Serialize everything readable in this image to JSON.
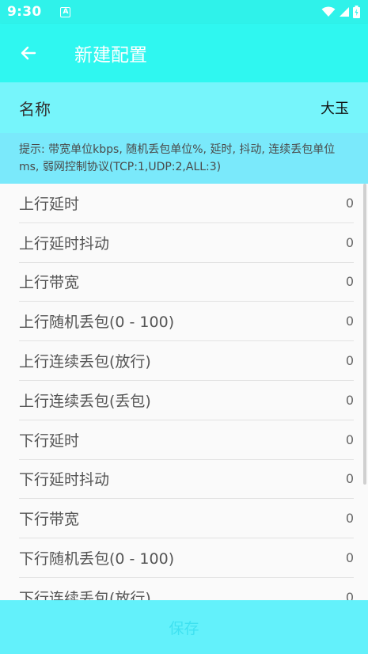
{
  "status_bar": {
    "time": "9:30",
    "notification_icon": "a-notification-icon",
    "icons": [
      "wifi-icon",
      "signal-icon",
      "battery-icon"
    ]
  },
  "app_bar": {
    "title": "新建配置",
    "back_icon": "arrow-left-icon"
  },
  "name_row": {
    "label": "名称",
    "value": "大玉"
  },
  "hint": "提示: 带宽单位kbps, 随机丢包单位%, 延时, 抖动, 连续丢包单位ms, 弱网控制协议(TCP:1,UDP:2,ALL:3)",
  "fields": [
    {
      "label": "上行延时",
      "value": "0"
    },
    {
      "label": "上行延时抖动",
      "value": "0"
    },
    {
      "label": "上行带宽",
      "value": "0"
    },
    {
      "label": "上行随机丢包(0 - 100)",
      "value": "0"
    },
    {
      "label": "上行连续丢包(放行)",
      "value": "0"
    },
    {
      "label": "上行连续丢包(丢包)",
      "value": "0"
    },
    {
      "label": "下行延时",
      "value": "0"
    },
    {
      "label": "下行延时抖动",
      "value": "0"
    },
    {
      "label": "下行带宽",
      "value": "0"
    },
    {
      "label": "下行随机丢包(0 - 100)",
      "value": "0"
    },
    {
      "label": "下行连续丢包(放行)",
      "value": "0"
    }
  ],
  "save_label": "保存",
  "colors": {
    "status_bar": "#2ff2ea",
    "app_bar": "#2ff7f0",
    "name_row": "#76f5fb",
    "hint_box": "#7ae9fb",
    "save_bar": "#63f1fb",
    "save_text": "#3fe1f0"
  }
}
